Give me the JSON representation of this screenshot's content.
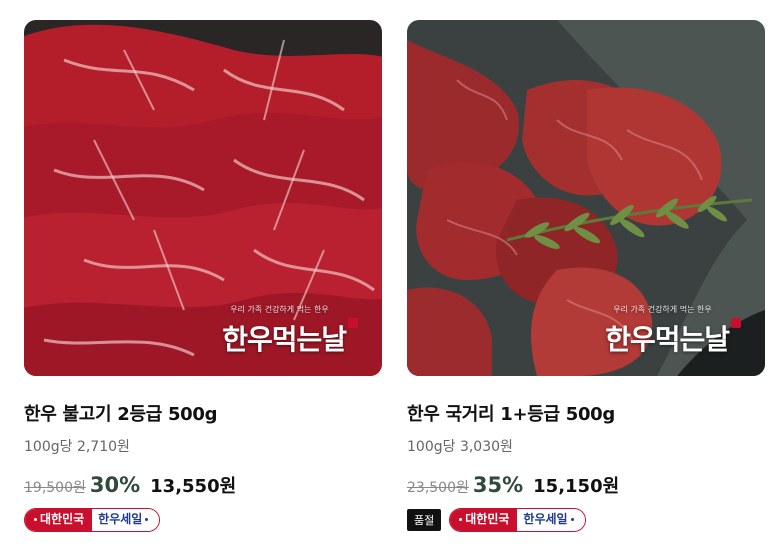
{
  "products": [
    {
      "title": "한우 불고기 2등급 500g",
      "unit_price": "100g당 2,710원",
      "original_price": "19,500원",
      "discount_rate": "30%",
      "final_price": "13,550원",
      "badge": {
        "left": "대한민국",
        "right": "한우세일"
      },
      "brand_mark": "한우먹는날",
      "brand_tagline": "우리 가족 건강하게 먹는 한우",
      "image_icon": "sliced-beef-image",
      "sold_out": null
    },
    {
      "title": "한우 국거리 1+등급 500g",
      "unit_price": "100g당 3,030원",
      "original_price": "23,500원",
      "discount_rate": "35%",
      "final_price": "15,150원",
      "badge": {
        "left": "대한민국",
        "right": "한우세일"
      },
      "brand_mark": "한우먹는날",
      "brand_tagline": "우리 가족 건강하게 먹는 한우",
      "image_icon": "cubed-beef-image",
      "sold_out": "품절"
    }
  ],
  "colors": {
    "discount": "#2f4a3a",
    "badge_red": "#c8102e",
    "badge_blue": "#1f3a93"
  }
}
